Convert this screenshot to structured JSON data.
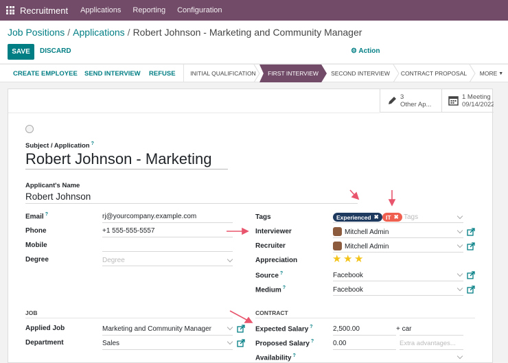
{
  "topbar": {
    "app": "Recruitment",
    "menus": [
      "Applications",
      "Reporting",
      "Configuration"
    ]
  },
  "breadcrumb": {
    "root": "Job Positions",
    "parent": "Applications",
    "current": "Robert Johnson - Marketing and Community Manager",
    "sep": "/"
  },
  "buttons": {
    "save": "SAVE",
    "discard": "DISCARD",
    "action": "Action"
  },
  "status_buttons": {
    "create": "CREATE EMPLOYEE",
    "send": "SEND INTERVIEW",
    "refuse": "REFUSE"
  },
  "stages": [
    "INITIAL QUALIFICATION",
    "FIRST INTERVIEW",
    "SECOND INTERVIEW",
    "CONTRACT PROPOSAL"
  ],
  "more": "MORE",
  "button_box": {
    "other_count": "3",
    "other_label": "Other Ap...",
    "meeting_count": "1 Meeting",
    "meeting_date": "09/14/2022"
  },
  "form": {
    "subject_label": "Subject / Application",
    "subject_value": "Robert Johnson - Marketing",
    "name_label": "Applicant's Name",
    "name_value": "Robert Johnson",
    "email_label": "Email",
    "email_value": "rj@yourcompany.example.com",
    "phone_label": "Phone",
    "phone_value": "+1 555-555-5557",
    "mobile_label": "Mobile",
    "degree_label": "Degree",
    "degree_placeholder": "Degree",
    "tags_label": "Tags",
    "tags": [
      "Experienced",
      "IT"
    ],
    "tags_placeholder": "Tags",
    "interviewer_label": "Interviewer",
    "interviewer_value": "Mitchell Admin",
    "recruiter_label": "Recruiter",
    "recruiter_value": "Mitchell Admin",
    "appreciation_label": "Appreciation",
    "appreciation_stars": 3,
    "source_label": "Source",
    "source_value": "Facebook",
    "medium_label": "Medium",
    "medium_value": "Facebook",
    "job_section": "JOB",
    "contract_section": "CONTRACT",
    "applied_job_label": "Applied Job",
    "applied_job_value": "Marketing and Community Manager",
    "department_label": "Department",
    "department_value": "Sales",
    "expected_label": "Expected Salary",
    "expected_value": "2,500.00",
    "expected_extra": "+ car",
    "proposed_label": "Proposed Salary",
    "proposed_value": "0.00",
    "proposed_placeholder": "Extra advantages...",
    "availability_label": "Availability"
  },
  "colors": {
    "brand": "#714b67",
    "accent": "#017e84",
    "annotation": "#e8556d"
  }
}
